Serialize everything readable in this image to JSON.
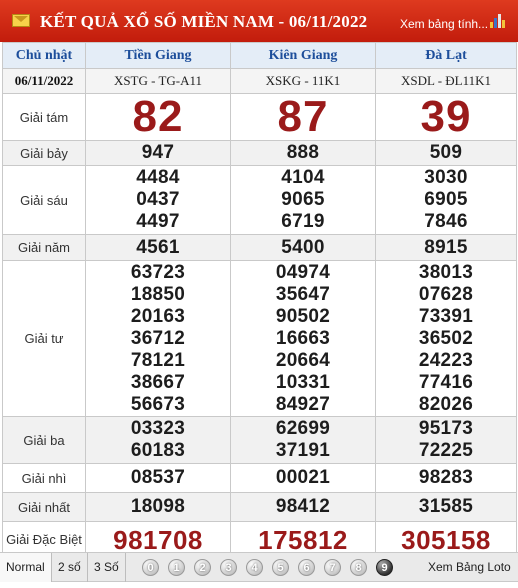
{
  "header": {
    "title": "KẾT QUẢ XỔ SỐ MIỀN NAM - 06/11/2022",
    "view_table_link": "Xem bảng tính...",
    "icons": {
      "mail": "mail-icon",
      "chart": "bar-chart-icon"
    }
  },
  "table": {
    "day": "Chủ nhật",
    "date": "06/11/2022",
    "provinces": [
      {
        "name": "Tiền Giang",
        "code": "XSTG - TG-A11"
      },
      {
        "name": "Kiên Giang",
        "code": "XSKG - 11K1"
      },
      {
        "name": "Đà Lạt",
        "code": "XSDL - ĐL11K1"
      }
    ],
    "prizes": [
      {
        "label": "Giải tám",
        "values": [
          [
            "82"
          ],
          [
            "87"
          ],
          [
            "39"
          ]
        ]
      },
      {
        "label": "Giải bảy",
        "values": [
          [
            "947"
          ],
          [
            "888"
          ],
          [
            "509"
          ]
        ]
      },
      {
        "label": "Giải sáu",
        "values": [
          [
            "4484",
            "0437",
            "4497"
          ],
          [
            "4104",
            "9065",
            "6719"
          ],
          [
            "3030",
            "6905",
            "7846"
          ]
        ]
      },
      {
        "label": "Giải năm",
        "values": [
          [
            "4561"
          ],
          [
            "5400"
          ],
          [
            "8915"
          ]
        ]
      },
      {
        "label": "Giải tư",
        "values": [
          [
            "63723",
            "18850",
            "20163",
            "36712",
            "78121",
            "38667",
            "56673"
          ],
          [
            "04974",
            "35647",
            "90502",
            "16663",
            "20664",
            "10331",
            "84927"
          ],
          [
            "38013",
            "07628",
            "73391",
            "36502",
            "24223",
            "77416",
            "82026"
          ]
        ]
      },
      {
        "label": "Giải ba",
        "values": [
          [
            "03323",
            "60183"
          ],
          [
            "62699",
            "37191"
          ],
          [
            "95173",
            "72225"
          ]
        ]
      },
      {
        "label": "Giải nhì",
        "values": [
          [
            "08537"
          ],
          [
            "00021"
          ],
          [
            "98283"
          ]
        ]
      },
      {
        "label": "Giải nhất",
        "values": [
          [
            "18098"
          ],
          [
            "98412"
          ],
          [
            "31585"
          ]
        ]
      },
      {
        "label": "Giải Đặc Biệt",
        "values": [
          [
            "981708"
          ],
          [
            "175812"
          ],
          [
            "305158"
          ]
        ]
      }
    ]
  },
  "footer": {
    "options": [
      "Normal",
      "2 số",
      "3 Số"
    ],
    "selected_option": "Normal",
    "digits": [
      "0",
      "1",
      "2",
      "3",
      "4",
      "5",
      "6",
      "7",
      "8",
      "9"
    ],
    "loto_link": "Xem Bảng Loto"
  },
  "colors": {
    "header_red": "#c21c0c",
    "province_blue": "#1d4e9b",
    "prize_red": "#9a1a1a"
  }
}
